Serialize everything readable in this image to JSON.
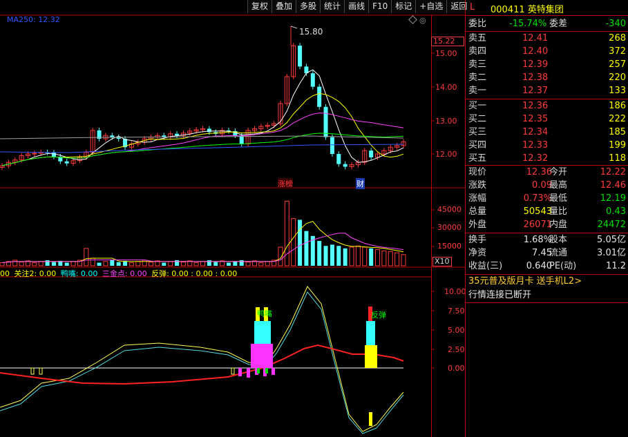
{
  "toolbar": {
    "buttons": [
      "复权",
      "叠加",
      "多股",
      "统计",
      "画线",
      "F10",
      "标记",
      "+自选",
      "返回"
    ]
  },
  "chart_top": {
    "ma_label": "MA250: 12.32",
    "peak_label": "15.80",
    "last_price_tag": "15.22",
    "y_ticks": [
      "15.00",
      "14.00",
      "13.00",
      "12.00"
    ],
    "annotations": [
      "涨榜",
      "财"
    ]
  },
  "chart_vol": {
    "y_ticks": [
      "45000",
      "30000",
      "15000"
    ],
    "scale_label": "X10"
  },
  "chart_ind": {
    "legend": {
      "v1": "00",
      "guanzhu": "关注2: 0.00",
      "yazui": "鸭嘴: 0.00",
      "sanjin": "三金点: 0.00",
      "fantan": "反弹: 0.00 : 0.00 : 0.00"
    },
    "y_ticks": [
      "10.00",
      "7.50",
      "5.00",
      "2.50",
      "0.00"
    ],
    "labels": [
      "鸭嘴",
      "反弹"
    ]
  },
  "quote": {
    "market_tag": "L",
    "code_name": "000411 英特集团",
    "weibi_label": "委比",
    "weibi": "-15.74%",
    "weicha_label": "委差",
    "weicha": "-340",
    "asks": [
      {
        "label": "卖五",
        "price": "12.41",
        "vol": "268"
      },
      {
        "label": "卖四",
        "price": "12.40",
        "vol": "372"
      },
      {
        "label": "卖三",
        "price": "12.39",
        "vol": "257"
      },
      {
        "label": "卖二",
        "price": "12.38",
        "vol": "220"
      },
      {
        "label": "卖一",
        "price": "12.37",
        "vol": "133"
      }
    ],
    "bids": [
      {
        "label": "买一",
        "price": "12.36",
        "vol": "186"
      },
      {
        "label": "买二",
        "price": "12.35",
        "vol": "222"
      },
      {
        "label": "买三",
        "price": "12.34",
        "vol": "185"
      },
      {
        "label": "买四",
        "price": "12.33",
        "vol": "199"
      },
      {
        "label": "买五",
        "price": "12.32",
        "vol": "118"
      }
    ],
    "stats": [
      {
        "l1": "现价",
        "v1": "12.36",
        "l2": "今开",
        "v2": "12.22"
      },
      {
        "l1": "涨跌",
        "v1": "0.09",
        "l2": "最高",
        "v2": "12.46"
      },
      {
        "l1": "涨幅",
        "v1": "0.73%",
        "l2": "最低",
        "v2": "12.19"
      },
      {
        "l1": "总量",
        "v1": "50543",
        "l2": "量比",
        "v2": "0.43"
      },
      {
        "l1": "外盘",
        "v1": "26071",
        "l2": "内盘",
        "v2": "24472"
      }
    ],
    "stats2": [
      {
        "l1": "换手",
        "v1": "1.68%",
        "l2": "股本",
        "v2": "5.05亿"
      },
      {
        "l1": "净资",
        "v1": "7.45",
        "l2": "流通",
        "v2": "3.01亿"
      },
      {
        "l1": "收益(三)",
        "v1": "0.640",
        "l2": "PE(动)",
        "v2": "11.2"
      }
    ],
    "promo": "35元普及版月卡 送手机L2>",
    "status": "行情连接已断开"
  }
}
